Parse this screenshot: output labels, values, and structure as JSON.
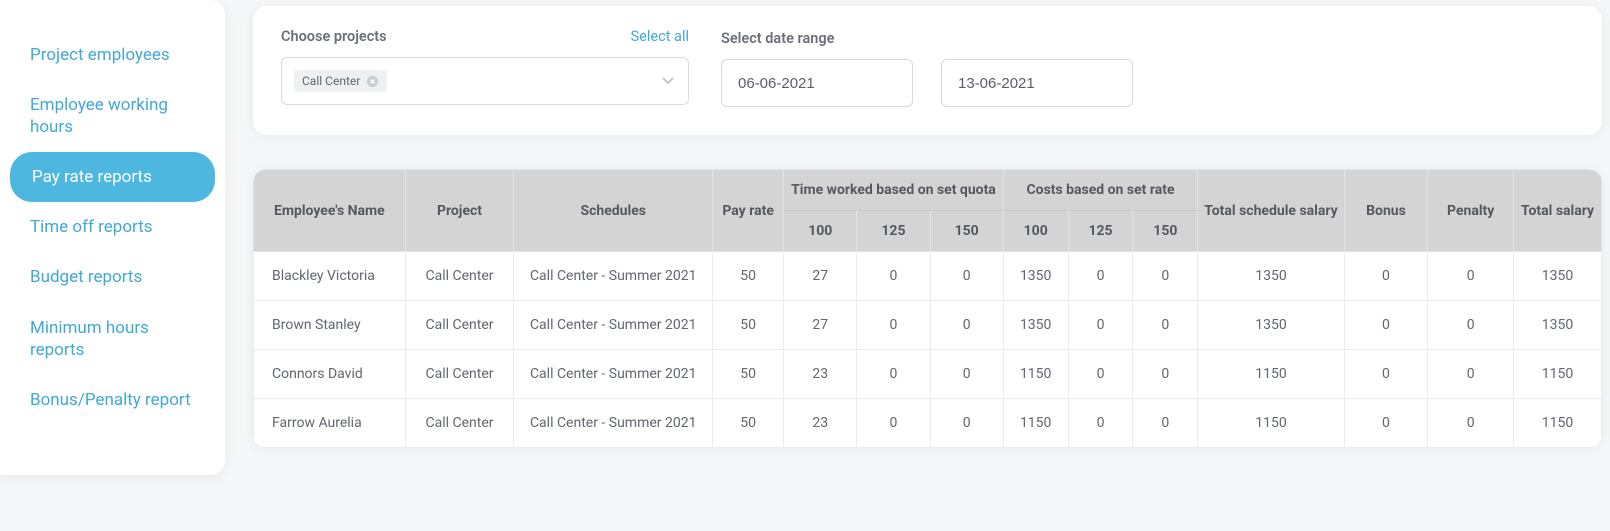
{
  "sidebar": {
    "items": [
      {
        "label": "Project employees",
        "active": false
      },
      {
        "label": "Employee working hours",
        "active": false
      },
      {
        "label": "Pay rate reports",
        "active": true
      },
      {
        "label": "Time off reports",
        "active": false
      },
      {
        "label": "Budget reports",
        "active": false
      },
      {
        "label": "Minimum hours reports",
        "active": false
      },
      {
        "label": "Bonus/Penalty report",
        "active": false
      }
    ]
  },
  "filters": {
    "choose_projects_label": "Choose projects",
    "select_all_label": "Select all",
    "selected_project": "Call Center",
    "date_range_label": "Select date range",
    "date_from": "06-06-2021",
    "date_to": "13-06-2021"
  },
  "table": {
    "headers": {
      "name": "Employee's Name",
      "project": "Project",
      "schedules": "Schedules",
      "pay_rate": "Pay rate",
      "time_worked_group": "Time worked based on set quota",
      "costs_group": "Costs based on set rate",
      "sub_100": "100",
      "sub_125": "125",
      "sub_150": "150",
      "total_schedule": "Total schedule salary",
      "bonus": "Bonus",
      "penalty": "Penalty",
      "total_salary": "Total salary"
    },
    "rows": [
      {
        "name": "Blackley Victoria",
        "project": "Call Center",
        "schedules": "Call Center - Summer 2021",
        "rate": "50",
        "t100": "27",
        "t125": "0",
        "t150": "0",
        "c100": "1350",
        "c125": "0",
        "c150": "0",
        "total_sched": "1350",
        "bonus": "0",
        "penalty": "0",
        "total": "1350"
      },
      {
        "name": "Brown Stanley",
        "project": "Call Center",
        "schedules": "Call Center - Summer 2021",
        "rate": "50",
        "t100": "27",
        "t125": "0",
        "t150": "0",
        "c100": "1350",
        "c125": "0",
        "c150": "0",
        "total_sched": "1350",
        "bonus": "0",
        "penalty": "0",
        "total": "1350"
      },
      {
        "name": "Connors David",
        "project": "Call Center",
        "schedules": "Call Center - Summer 2021",
        "rate": "50",
        "t100": "23",
        "t125": "0",
        "t150": "0",
        "c100": "1150",
        "c125": "0",
        "c150": "0",
        "total_sched": "1150",
        "bonus": "0",
        "penalty": "0",
        "total": "1150"
      },
      {
        "name": "Farrow Aurelia",
        "project": "Call Center",
        "schedules": "Call Center - Summer 2021",
        "rate": "50",
        "t100": "23",
        "t125": "0",
        "t150": "0",
        "c100": "1150",
        "c125": "0",
        "c150": "0",
        "total_sched": "1150",
        "bonus": "0",
        "penalty": "0",
        "total": "1150"
      }
    ]
  }
}
